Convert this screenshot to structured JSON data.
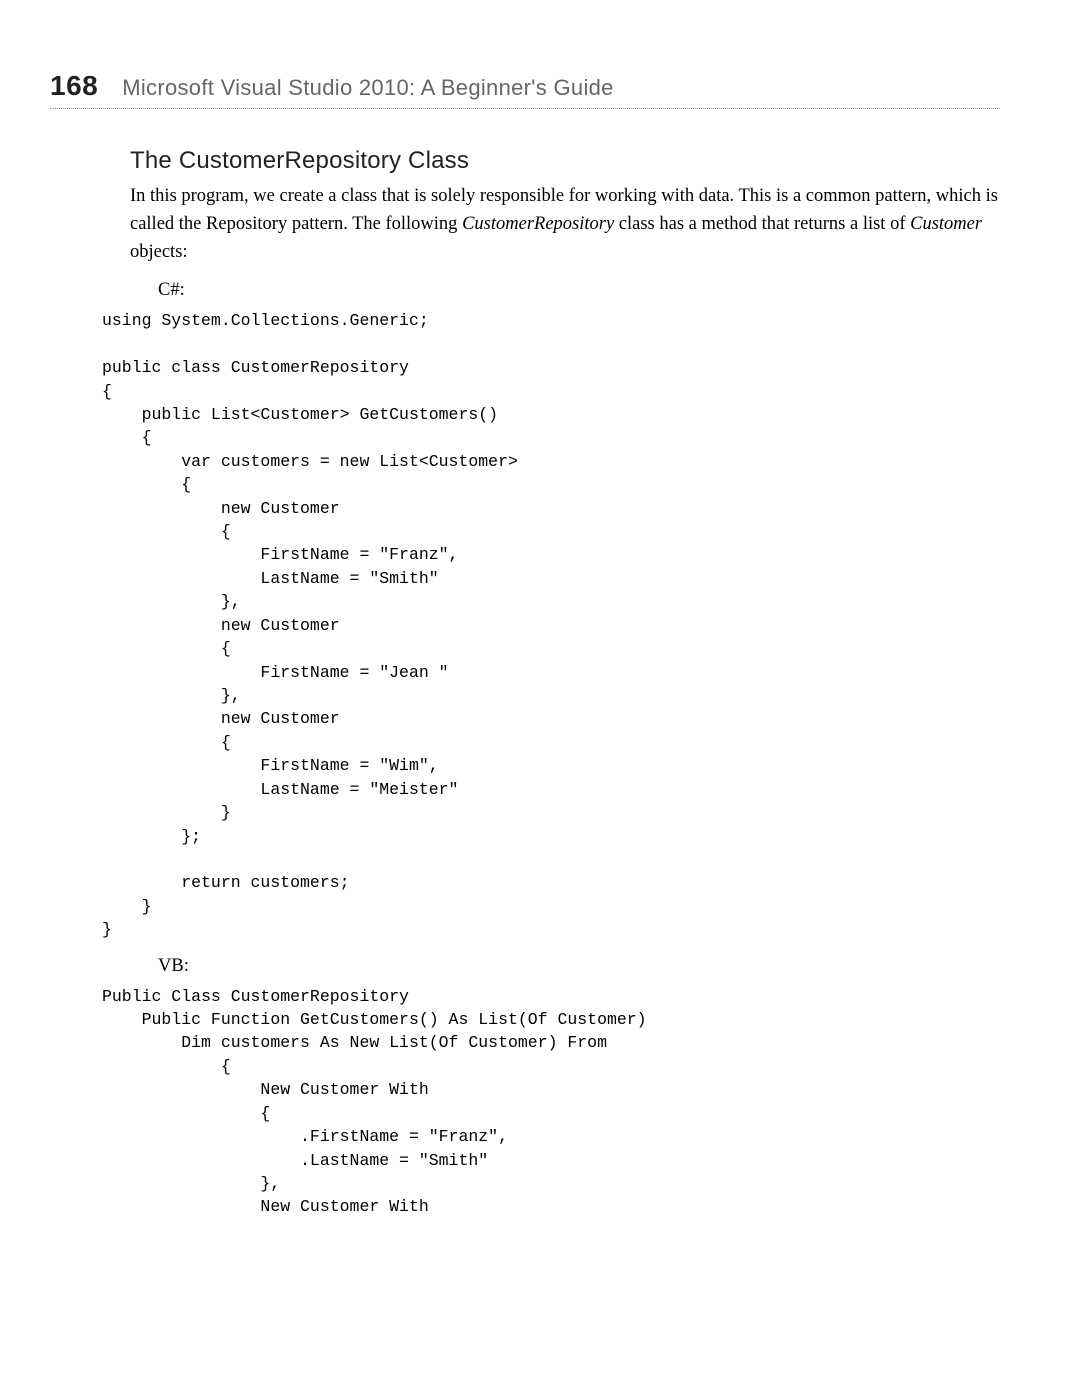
{
  "header": {
    "page_number": "168",
    "running_title": "Microsoft Visual Studio 2010: A Beginner's Guide"
  },
  "section": {
    "heading": "The CustomerRepository Class",
    "paragraph_pre": "In this program, we create a class that is solely responsible for working with data. This is a common pattern, which is called the Repository pattern. The following ",
    "paragraph_em1": "CustomerRepository",
    "paragraph_mid": " class has a method that returns a list of ",
    "paragraph_em2": "Customer",
    "paragraph_post": " objects:"
  },
  "csharp": {
    "label": "C#:",
    "code": "using System.Collections.Generic;\n\npublic class CustomerRepository\n{\n    public List<Customer> GetCustomers()\n    {\n        var customers = new List<Customer>\n        {\n            new Customer\n            {\n                FirstName = \"Franz\",\n                LastName = \"Smith\"\n            },\n            new Customer\n            {\n                FirstName = \"Jean \"\n            },\n            new Customer\n            {\n                FirstName = \"Wim\",\n                LastName = \"Meister\"\n            }\n        };\n\n        return customers;\n    }\n}"
  },
  "vb": {
    "label": "VB:",
    "code": "Public Class CustomerRepository\n    Public Function GetCustomers() As List(Of Customer)\n        Dim customers As New List(Of Customer) From\n            {\n                New Customer With\n                {\n                    .FirstName = \"Franz\",\n                    .LastName = \"Smith\"\n                },\n                New Customer With"
  }
}
